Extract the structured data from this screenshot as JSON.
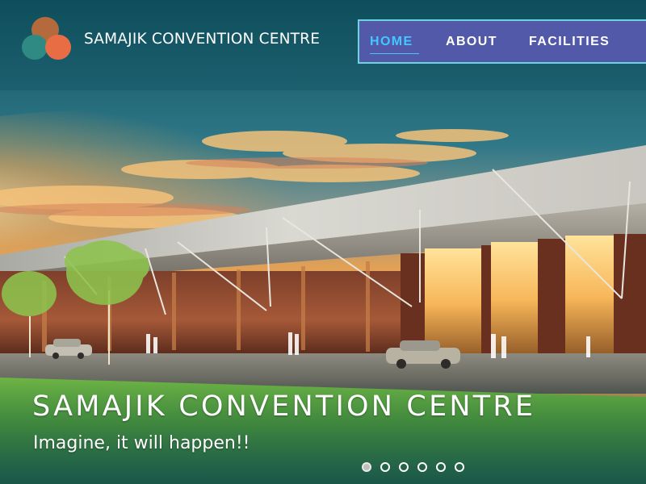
{
  "header": {
    "brand": "SAMAJIK CONVENTION CENTRE",
    "nav": [
      {
        "label": "HOME",
        "active": true
      },
      {
        "label": "ABOUT",
        "active": false
      },
      {
        "label": "FACILITIES",
        "active": false
      }
    ]
  },
  "hero": {
    "title": "SAMAJIK CONVENTION CENTRE",
    "subtitle": "Imagine, it will happen!!",
    "slide_count": 6,
    "active_slide": 1
  },
  "colors": {
    "nav_background": "#5259a8",
    "nav_border": "#6fd3df",
    "nav_active": "#43c7ff",
    "hero_top": "#0f4f5c",
    "sky_glow": "#f3a14b",
    "brick": "#8b4933",
    "lawn": "#5faf3b"
  },
  "icons": {
    "logo": "three-circles-logo-icon",
    "pager": "carousel-dot-icon"
  }
}
